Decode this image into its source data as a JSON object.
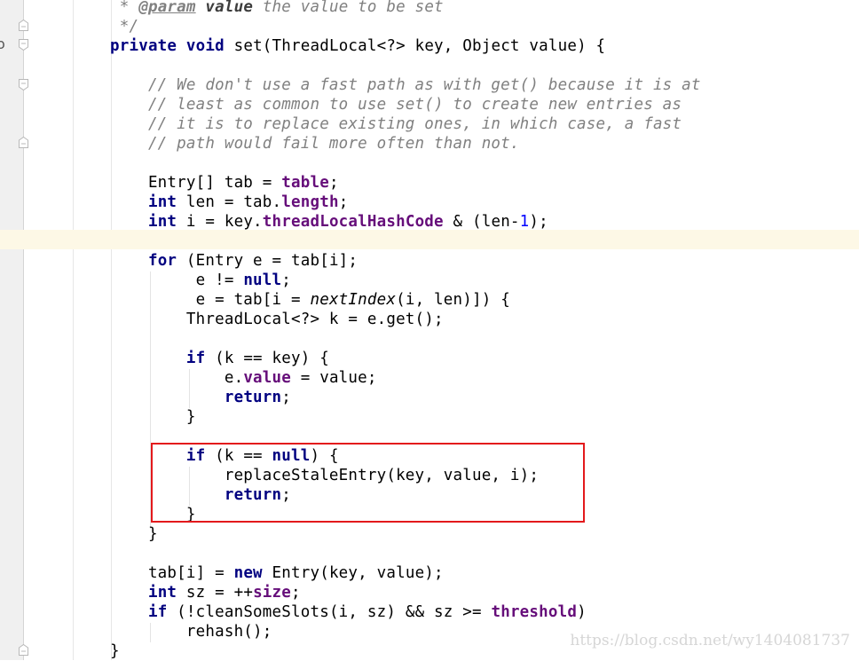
{
  "editor": {
    "language": "java",
    "gutter_marker": "o",
    "lines": [
      {
        "tokens": [
          {
            "t": " * ",
            "c": "cmt"
          },
          {
            "t": "@param",
            "c": "doctag"
          },
          {
            "t": " ",
            "c": "cmt"
          },
          {
            "t": "value",
            "c": "docparam"
          },
          {
            "t": " the value to be set",
            "c": "cmt"
          }
        ]
      },
      {
        "tokens": [
          {
            "t": " */",
            "c": "cmt"
          }
        ]
      },
      {
        "tokens": [
          {
            "t": "private",
            "c": "kw"
          },
          {
            "t": " "
          },
          {
            "t": "void",
            "c": "kw"
          },
          {
            "t": " set(ThreadLocal<?> key, Object value) {"
          }
        ]
      },
      {
        "tokens": []
      },
      {
        "tokens": [
          {
            "t": "    // We don't use a fast path as with get() because it is at",
            "c": "cmt"
          }
        ]
      },
      {
        "tokens": [
          {
            "t": "    // least as common to use set() to create new entries as",
            "c": "cmt"
          }
        ]
      },
      {
        "tokens": [
          {
            "t": "    // it is to replace existing ones, in which case, a fast",
            "c": "cmt"
          }
        ]
      },
      {
        "tokens": [
          {
            "t": "    // path would fail more often than not.",
            "c": "cmt"
          }
        ]
      },
      {
        "tokens": []
      },
      {
        "tokens": [
          {
            "t": "    Entry[] tab = "
          },
          {
            "t": "table",
            "c": "fld"
          },
          {
            "t": ";"
          }
        ]
      },
      {
        "tokens": [
          {
            "t": "    "
          },
          {
            "t": "int",
            "c": "kw"
          },
          {
            "t": " len = tab."
          },
          {
            "t": "length",
            "c": "fld"
          },
          {
            "t": ";"
          }
        ]
      },
      {
        "tokens": [
          {
            "t": "    "
          },
          {
            "t": "int",
            "c": "kw"
          },
          {
            "t": " i = key."
          },
          {
            "t": "threadLocalHashCode",
            "c": "fld"
          },
          {
            "t": " & (len-"
          },
          {
            "t": "1",
            "c": "num"
          },
          {
            "t": ");"
          }
        ]
      },
      {
        "tokens": []
      },
      {
        "tokens": [
          {
            "t": "    "
          },
          {
            "t": "for",
            "c": "kw"
          },
          {
            "t": " (Entry e = tab[i];"
          }
        ]
      },
      {
        "tokens": [
          {
            "t": "         e != "
          },
          {
            "t": "null",
            "c": "kw"
          },
          {
            "t": ";"
          }
        ]
      },
      {
        "tokens": [
          {
            "t": "         e = tab[i = "
          },
          {
            "t": "nextIndex",
            "c": "stat"
          },
          {
            "t": "(i, len)]) {"
          }
        ]
      },
      {
        "tokens": [
          {
            "t": "        ThreadLocal<?> k = e.get();"
          }
        ]
      },
      {
        "tokens": []
      },
      {
        "tokens": [
          {
            "t": "        "
          },
          {
            "t": "if",
            "c": "kw"
          },
          {
            "t": " (k == key) {"
          }
        ]
      },
      {
        "tokens": [
          {
            "t": "            e."
          },
          {
            "t": "value",
            "c": "fld"
          },
          {
            "t": " = value;"
          }
        ]
      },
      {
        "tokens": [
          {
            "t": "            "
          },
          {
            "t": "return",
            "c": "kw"
          },
          {
            "t": ";"
          }
        ]
      },
      {
        "tokens": [
          {
            "t": "        }"
          }
        ]
      },
      {
        "tokens": []
      },
      {
        "tokens": [
          {
            "t": "        "
          },
          {
            "t": "if",
            "c": "kw"
          },
          {
            "t": " (k == "
          },
          {
            "t": "null",
            "c": "kw"
          },
          {
            "t": ") {"
          }
        ]
      },
      {
        "tokens": [
          {
            "t": "            replaceStaleEntry(key, value, i);"
          }
        ]
      },
      {
        "tokens": [
          {
            "t": "            "
          },
          {
            "t": "return",
            "c": "kw"
          },
          {
            "t": ";"
          }
        ]
      },
      {
        "tokens": [
          {
            "t": "        }"
          }
        ]
      },
      {
        "tokens": [
          {
            "t": "    }"
          }
        ]
      },
      {
        "tokens": []
      },
      {
        "tokens": [
          {
            "t": "    tab[i] = "
          },
          {
            "t": "new",
            "c": "kw"
          },
          {
            "t": " Entry(key, value);"
          }
        ]
      },
      {
        "tokens": [
          {
            "t": "    "
          },
          {
            "t": "int",
            "c": "kw"
          },
          {
            "t": " sz = ++"
          },
          {
            "t": "size",
            "c": "fld"
          },
          {
            "t": ";"
          }
        ]
      },
      {
        "tokens": [
          {
            "t": "    "
          },
          {
            "t": "if",
            "c": "kw"
          },
          {
            "t": " (!cleanSomeSlots(i, sz) && sz >= "
          },
          {
            "t": "threshold",
            "c": "fld"
          },
          {
            "t": ")"
          }
        ]
      },
      {
        "tokens": [
          {
            "t": "        rehash();"
          }
        ]
      },
      {
        "tokens": [
          {
            "t": "}"
          }
        ]
      }
    ]
  },
  "highlight": {
    "description": "if (k == null) block",
    "color": "#e3191c"
  },
  "watermark": "https://blog.csdn.net/wy1404081737"
}
